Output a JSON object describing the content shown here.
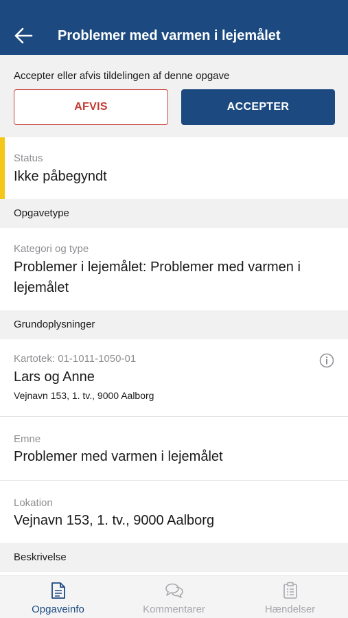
{
  "header": {
    "title": "Problemer med varmen i lejemålet",
    "back_icon": "arrow-left-icon"
  },
  "assignment": {
    "prompt": "Accepter eller afvis tildelingen af denne opgave",
    "reject_label": "AFVIS",
    "accept_label": "ACCEPTER"
  },
  "status": {
    "label": "Status",
    "value": "Ikke påbegyndt",
    "indicator_color": "#f5c71a"
  },
  "sections": {
    "opgavetype": "Opgavetype",
    "grundoplysninger": "Grundoplysninger",
    "beskrivelse": "Beskrivelse"
  },
  "category": {
    "label": "Kategori og type",
    "value_line1": "Problemer i lejemålet: Problemer med varmen i",
    "value_line2": "lejemålet"
  },
  "tenant": {
    "label": "Kartotek: 01-1011-1050-01",
    "name": "Lars og Anne",
    "address": "Vejnavn 153, 1. tv., 9000 Aalborg"
  },
  "subject": {
    "label": "Emne",
    "value": "Problemer med varmen i lejemålet"
  },
  "location": {
    "label": "Lokation",
    "value": "Vejnavn 153, 1. tv., 9000 Aalborg"
  },
  "tabs": [
    {
      "label": "Opgaveinfo",
      "icon": "document-icon",
      "active": true
    },
    {
      "label": "Kommentarer",
      "icon": "chat-bubbles-icon",
      "active": false
    },
    {
      "label": "Hændelser",
      "icon": "clipboard-icon",
      "active": false
    }
  ],
  "colors": {
    "primary": "#1c4a80",
    "danger": "#c23a33",
    "status_pending": "#f5c71a"
  }
}
